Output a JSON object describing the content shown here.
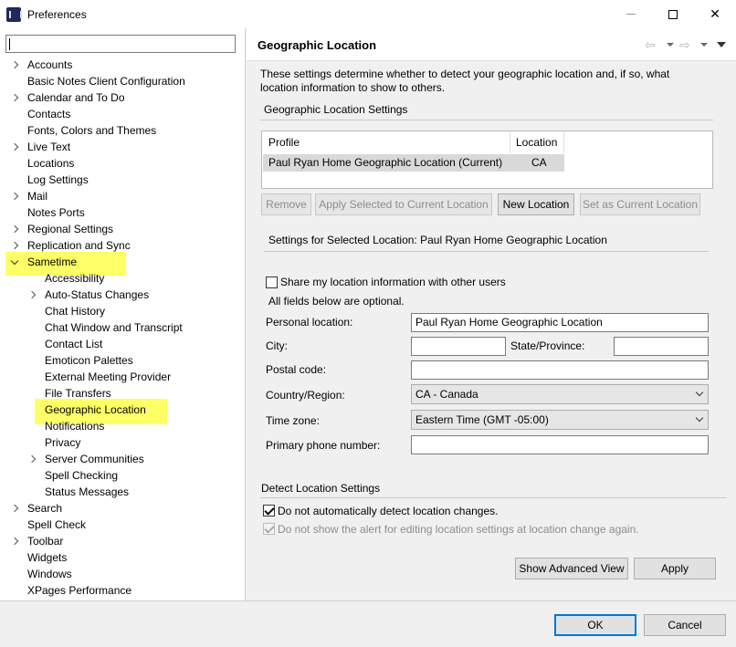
{
  "window": {
    "title": "Preferences"
  },
  "tree": {
    "filter_value": "",
    "items": [
      {
        "label": "Accounts",
        "expander": "collapsed"
      },
      {
        "label": "Basic Notes Client Configuration",
        "expander": "none"
      },
      {
        "label": "Calendar and To Do",
        "expander": "collapsed"
      },
      {
        "label": "Contacts",
        "expander": "none"
      },
      {
        "label": "Fonts, Colors and Themes",
        "expander": "none"
      },
      {
        "label": "Live Text",
        "expander": "collapsed"
      },
      {
        "label": "Locations",
        "expander": "none"
      },
      {
        "label": "Log Settings",
        "expander": "none"
      },
      {
        "label": "Mail",
        "expander": "collapsed"
      },
      {
        "label": "Notes Ports",
        "expander": "none"
      },
      {
        "label": "Regional Settings",
        "expander": "collapsed"
      },
      {
        "label": "Replication and Sync",
        "expander": "collapsed"
      },
      {
        "label": "Sametime",
        "expander": "expanded",
        "highlight": true
      },
      {
        "label": "Accessibility",
        "expander": "none",
        "child": true
      },
      {
        "label": "Auto-Status Changes",
        "expander": "collapsed",
        "child": true
      },
      {
        "label": "Chat History",
        "expander": "none",
        "child": true
      },
      {
        "label": "Chat Window and Transcript",
        "expander": "none",
        "child": true
      },
      {
        "label": "Contact List",
        "expander": "none",
        "child": true
      },
      {
        "label": "Emoticon Palettes",
        "expander": "none",
        "child": true
      },
      {
        "label": "External Meeting Provider",
        "expander": "none",
        "child": true
      },
      {
        "label": "File Transfers",
        "expander": "none",
        "child": true
      },
      {
        "label": "Geographic Location",
        "expander": "none",
        "child": true,
        "highlight": true
      },
      {
        "label": "Notifications",
        "expander": "none",
        "child": true
      },
      {
        "label": "Privacy",
        "expander": "none",
        "child": true
      },
      {
        "label": "Server Communities",
        "expander": "collapsed",
        "child": true
      },
      {
        "label": "Spell Checking",
        "expander": "none",
        "child": true
      },
      {
        "label": "Status Messages",
        "expander": "none",
        "child": true
      },
      {
        "label": "Search",
        "expander": "collapsed"
      },
      {
        "label": "Spell Check",
        "expander": "none"
      },
      {
        "label": "Toolbar",
        "expander": "collapsed"
      },
      {
        "label": "Widgets",
        "expander": "none"
      },
      {
        "label": "Windows",
        "expander": "none"
      },
      {
        "label": "XPages Performance",
        "expander": "none"
      }
    ]
  },
  "page": {
    "title": "Geographic Location",
    "description": "These settings determine whether to detect your geographic location and, if so, what location information to show to others.",
    "settings_section": "Geographic Location Settings",
    "table": {
      "columns": [
        "Profile",
        "Location"
      ],
      "rows": [
        {
          "profile": "Paul Ryan Home Geographic Location (Current)",
          "location": "CA"
        }
      ]
    },
    "buttons": {
      "remove": "Remove",
      "apply_selected": "Apply Selected to Current Location",
      "new_location": "New Location",
      "set_current": "Set as Current Location"
    },
    "selected_section": "Settings for Selected Location: Paul Ryan Home Geographic Location",
    "share_label": "Share my location information with other users",
    "optional_note": "All fields below are optional.",
    "fields": {
      "personal_location_label": "Personal location:",
      "personal_location_value": "Paul Ryan Home Geographic Location",
      "city_label": "City:",
      "city_value": "",
      "state_label": "State/Province:",
      "state_value": "",
      "postal_label": "Postal code:",
      "postal_value": "",
      "country_label": "Country/Region:",
      "country_value": "CA - Canada",
      "timezone_label": "Time zone:",
      "timezone_value": "Eastern Time (GMT -05:00)",
      "phone_label": "Primary phone number:",
      "phone_value": ""
    },
    "detect_section": "Detect Location Settings",
    "detect_auto_label": "Do not automatically detect location changes.",
    "detect_alert_label": "Do not show the alert for editing location settings at location change again.",
    "show_advanced": "Show Advanced View",
    "apply": "Apply"
  },
  "footer": {
    "ok": "OK",
    "cancel": "Cancel"
  },
  "colors": {
    "highlight": "#ffff66",
    "accent": "#0078d7"
  }
}
